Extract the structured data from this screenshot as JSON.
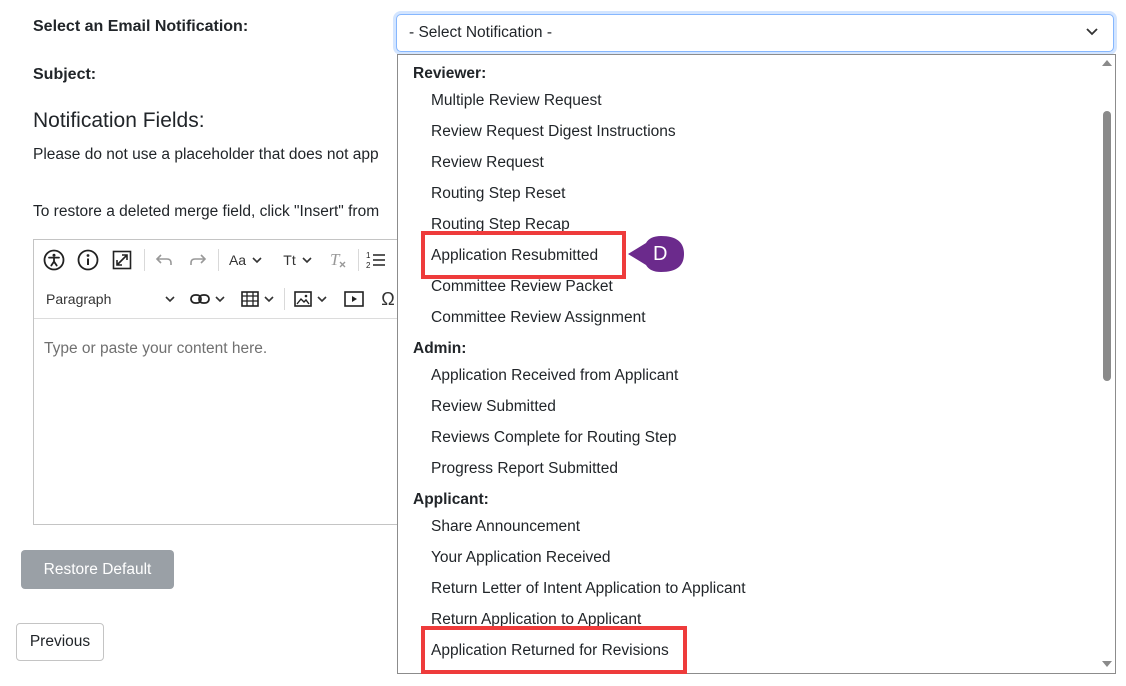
{
  "form": {
    "select_label": "Select an Email Notification:",
    "subject_label": "Subject:",
    "fields_title": "Notification Fields:",
    "placeholder_note": "Please do not use a placeholder that does not app",
    "restore_note": "To restore a deleted merge field, click \"Insert\" from"
  },
  "editor": {
    "paragraph_label": "Paragraph",
    "font_size_label": "Aa",
    "text_transform_label": "Tt",
    "placeholder": "Type or paste your content here."
  },
  "buttons": {
    "restore_default": "Restore Default",
    "previous": "Previous"
  },
  "select": {
    "value": "- Select Notification -",
    "groups": [
      {
        "label": "Reviewer:",
        "options": [
          "Multiple Review Request",
          "Review Request Digest Instructions",
          "Review Request",
          "Routing Step Reset",
          "Routing Step Recap",
          "Application Resubmitted",
          "Committee Review Packet",
          "Committee Review Assignment"
        ]
      },
      {
        "label": "Admin:",
        "options": [
          "Application Received from Applicant",
          "Review Submitted",
          "Reviews Complete for Routing Step",
          "Progress Report Submitted"
        ]
      },
      {
        "label": "Applicant:",
        "options": [
          "Share Announcement",
          "Your Application Received",
          "Return Letter of Intent Application to Applicant",
          "Return Application to Applicant",
          "Application Returned for Revisions"
        ]
      }
    ]
  },
  "annotation": {
    "callout_letter": "D",
    "callout_color": "#6b2a8c",
    "highlight_color": "#ee3b3b"
  }
}
